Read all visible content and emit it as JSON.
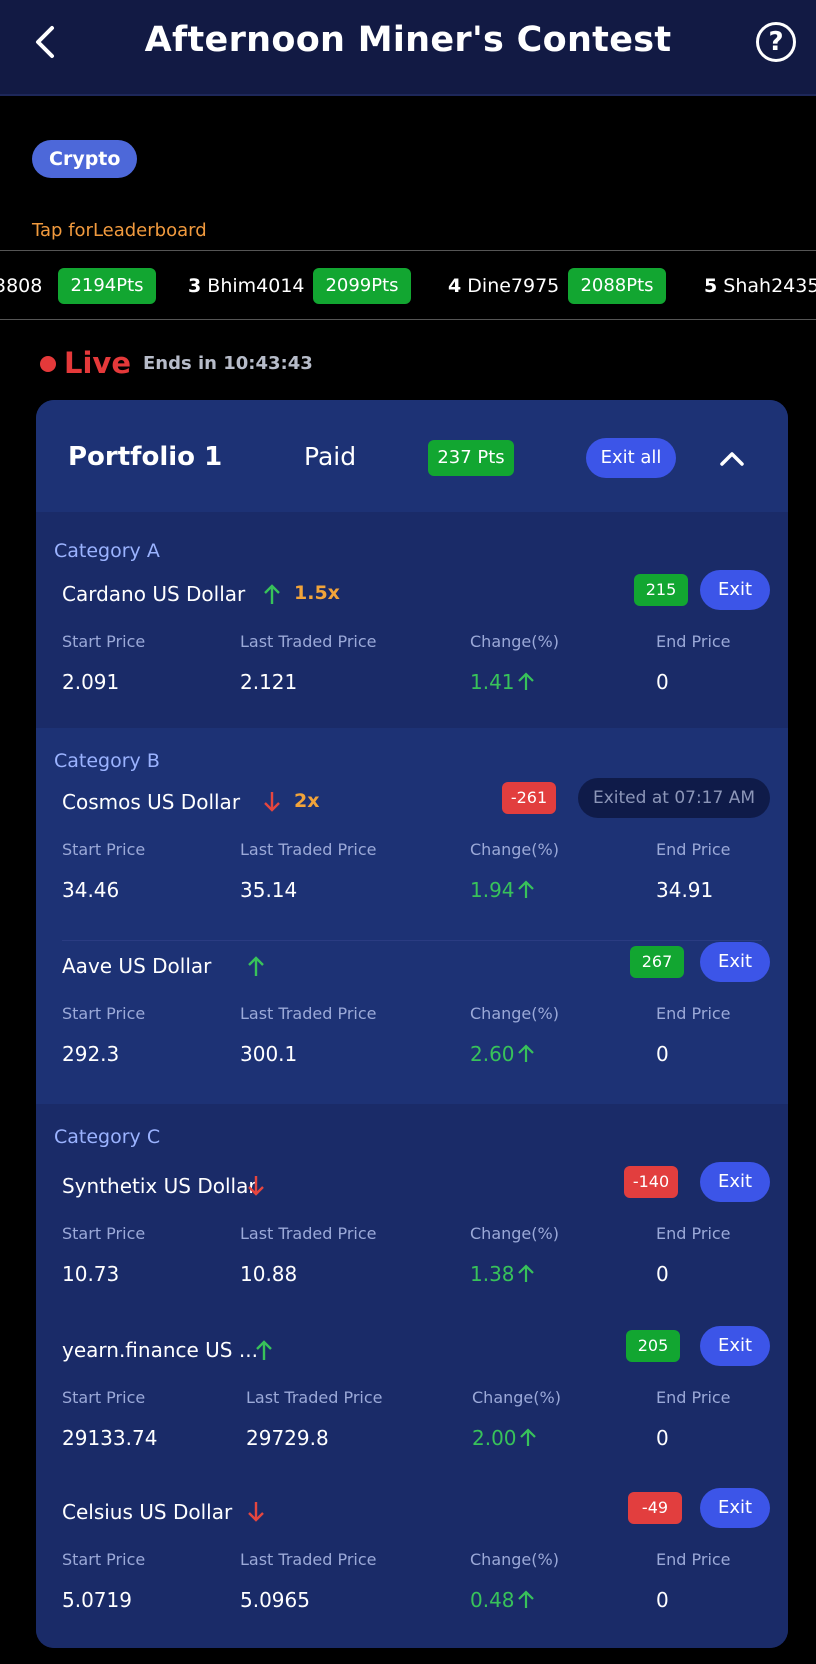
{
  "header": {
    "title": "Afternoon Miner's Contest",
    "help_icon": "?"
  },
  "filter_chip": "Crypto",
  "leaderboard": {
    "tap_text": "Tap forLeaderboard",
    "entries": [
      {
        "rank": "",
        "name": "3808",
        "points": "2194Pts"
      },
      {
        "rank": "3",
        "name": "Bhim4014",
        "points": "2099Pts"
      },
      {
        "rank": "4",
        "name": "Dine7975",
        "points": "2088Pts"
      },
      {
        "rank": "5",
        "name": "Shah2435",
        "points": ""
      }
    ]
  },
  "status": {
    "live": "Live",
    "ends": "Ends in 10:43:43"
  },
  "portfolio": {
    "name": "Portfolio 1",
    "type": "Paid",
    "points": "237 Pts",
    "exit_all": "Exit all"
  },
  "labels": {
    "start": "Start Price",
    "ltp": "Last Traded Price",
    "change": "Change(%)",
    "end": "End Price",
    "exit": "Exit"
  },
  "colors": {
    "positive": "#12a631",
    "negative": "#e23e3e",
    "accent": "#3c55e8",
    "multiplier": "#f2a43a"
  },
  "categories": [
    {
      "title": "Category A",
      "assets": [
        {
          "name": "Cardano US Dollar",
          "trend": "up",
          "multiplier": "1.5x",
          "points": "215",
          "start": "2.091",
          "ltp": "2.121",
          "change": "1.41",
          "end": "0"
        }
      ]
    },
    {
      "title": "Category B",
      "assets": [
        {
          "name": "Cosmos US Dollar",
          "trend": "down",
          "multiplier": "2x",
          "points": "-261",
          "exited": "Exited at 07:17 AM",
          "start": "34.46",
          "ltp": "35.14",
          "change": "1.94",
          "end": "34.91"
        },
        {
          "name": "Aave US Dollar",
          "trend": "up",
          "points": "267",
          "start": "292.3",
          "ltp": "300.1",
          "change": "2.60",
          "end": "0"
        }
      ]
    },
    {
      "title": "Category C",
      "assets": [
        {
          "name": "Synthetix US Dollar",
          "trend": "down",
          "points": "-140",
          "start": "10.73",
          "ltp": "10.88",
          "change": "1.38",
          "end": "0"
        },
        {
          "name": "yearn.finance US ...",
          "trend": "up",
          "points": "205",
          "start": "29133.74",
          "ltp": "29729.8",
          "change": "2.00",
          "end": "0"
        },
        {
          "name": "Celsius US Dollar",
          "trend": "down",
          "points": "-49",
          "start": "5.0719",
          "ltp": "5.0965",
          "change": "0.48",
          "end": "0"
        }
      ]
    }
  ]
}
